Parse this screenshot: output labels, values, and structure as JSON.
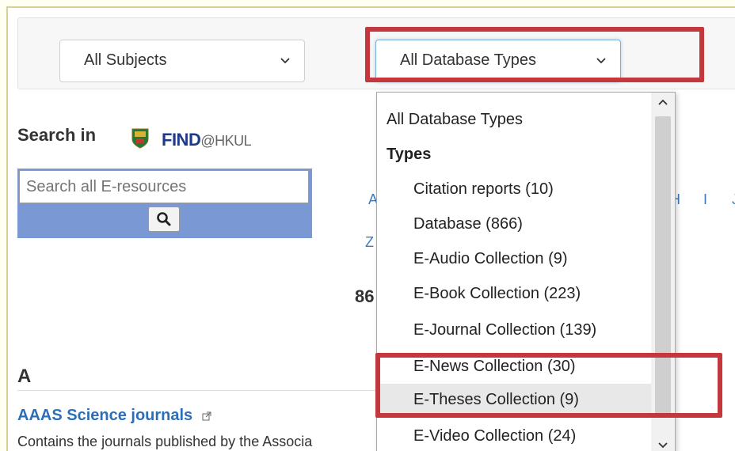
{
  "filters": {
    "subjects": {
      "selected": "All Subjects"
    },
    "database_types": {
      "selected": "All Database Types"
    }
  },
  "search": {
    "label": "Search in",
    "logo_main": "FIND",
    "logo_suffix": "@HKUL",
    "placeholder": "Search all E-resources",
    "button_icon": "search-icon"
  },
  "alpha_nav": {
    "letters": [
      "A",
      "H",
      "I",
      "J",
      "Z"
    ]
  },
  "results": {
    "count_prefix": "86",
    "section_letter": "A",
    "first": {
      "title": "AAAS Science journals",
      "description": "Contains the journals published by the Associa"
    }
  },
  "dropdown": {
    "options": [
      {
        "label": "All Database Types",
        "kind": "head"
      },
      {
        "label": "Types",
        "kind": "group"
      },
      {
        "label": "Citation reports (10)",
        "kind": "item"
      },
      {
        "label": "Database (866)",
        "kind": "item"
      },
      {
        "label": "E-Audio Collection (9)",
        "kind": "item"
      },
      {
        "label": "E-Book Collection (223)",
        "kind": "item"
      },
      {
        "label": "E-Journal Collection (139)",
        "kind": "item"
      },
      {
        "label": "E-News Collection (30)",
        "kind": "item"
      },
      {
        "label": "E-Theses Collection (9)",
        "kind": "item",
        "hovered": true
      },
      {
        "label": "E-Video Collection (24)",
        "kind": "item"
      }
    ]
  },
  "colors": {
    "highlight": "#c4373c",
    "link": "#2c6fb8",
    "search_panel": "#7a98d4"
  }
}
